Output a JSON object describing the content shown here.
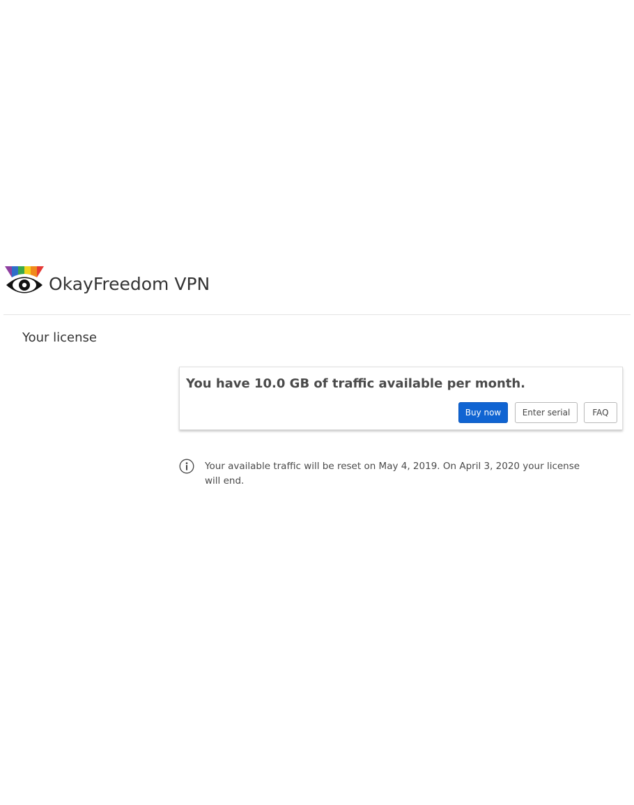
{
  "app": {
    "title": "OkayFreedom VPN",
    "logo_icon": "rainbow-eye-logo-icon",
    "logo_colors": [
      "#8e3fa0",
      "#2f6ec8",
      "#3aa84a",
      "#f2d21b",
      "#f08a1c",
      "#e53935"
    ]
  },
  "license": {
    "section_title": "Your license",
    "headline": "You have 10.0 GB of traffic available per month.",
    "buttons": {
      "buy_now": "Buy now",
      "enter_serial": "Enter serial",
      "faq": "FAQ"
    },
    "info_icon": "info-circle-icon",
    "info_text": "Your available traffic will be reset on May 4, 2019. On April 3, 2020 your license will end."
  },
  "colors": {
    "accent": "#1064d2",
    "text": "#333333",
    "divider": "#e3e3e3"
  }
}
